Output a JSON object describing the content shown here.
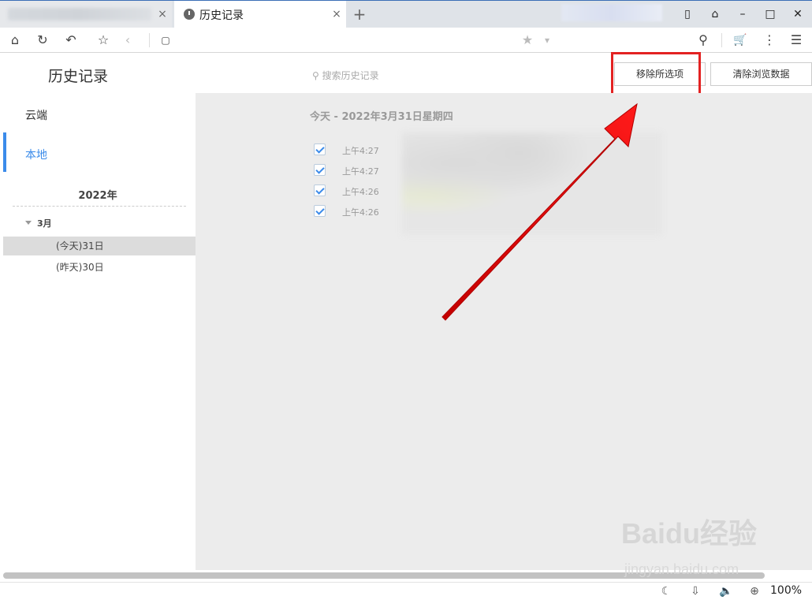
{
  "window": {
    "active_tab_title": "历史记录",
    "new_tab_symbol": "+",
    "close_symbol": "×",
    "controls": [
      "▯",
      "⌂",
      "–",
      "□",
      "✕"
    ]
  },
  "toolbar": {
    "home": "⌂",
    "refresh": "↻",
    "undo": "↶",
    "favorite": "☆",
    "back": "‹",
    "page": "▢",
    "star": "★",
    "dropdown": "▾",
    "search": "⚲",
    "cart": "🛒",
    "more": "⋮",
    "menu": "☰"
  },
  "page": {
    "title": "历史记录",
    "search_placeholder": "搜索历史记录",
    "remove_selected": "移除所选项",
    "clear_data": "清除浏览数据"
  },
  "sidebar": {
    "cloud": "云端",
    "local": "本地",
    "year": "2022年",
    "month": "3月",
    "days": [
      "(今天)31日",
      "(昨天)30日"
    ]
  },
  "history": {
    "date_header": "今天 - 2022年3月31日星期四",
    "entries": [
      {
        "time": "上午4:27",
        "checked": true
      },
      {
        "time": "上午4:27",
        "checked": true
      },
      {
        "time": "上午4:26",
        "checked": true
      },
      {
        "time": "上午4:26",
        "checked": true
      }
    ]
  },
  "status": {
    "zoom": "100%"
  },
  "watermark": {
    "text": "Baidu经验",
    "url": "jingyan.baidu.com"
  },
  "colors": {
    "accent": "#3b8bea",
    "annotation": "#e32222"
  }
}
